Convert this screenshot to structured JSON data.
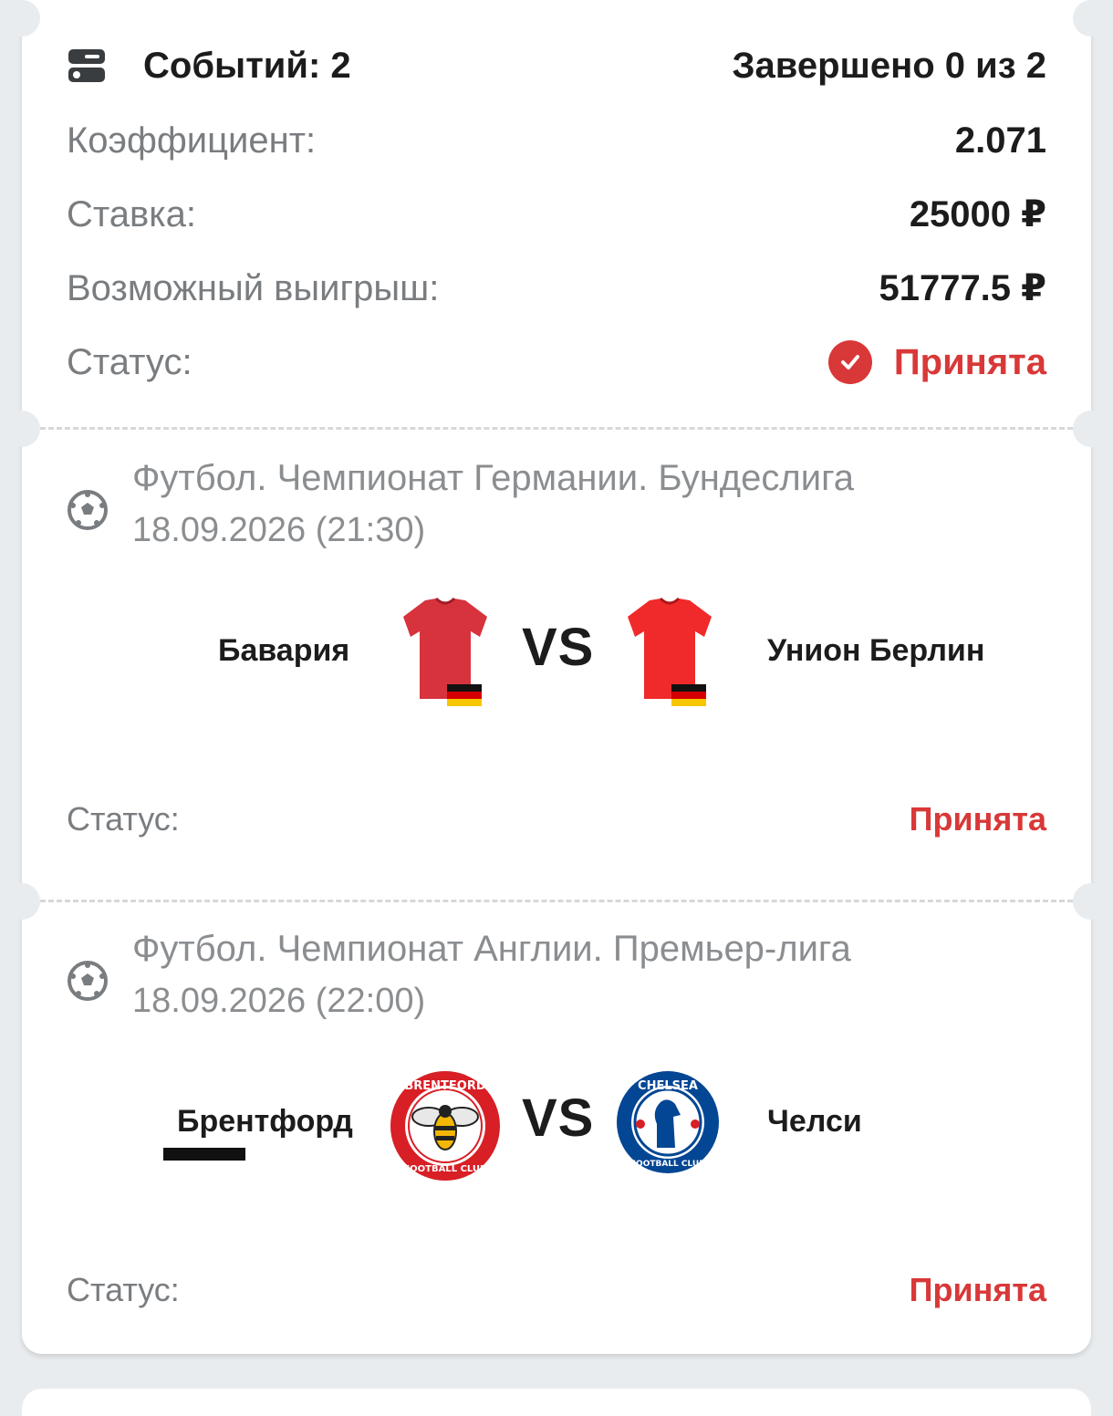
{
  "summary": {
    "events_label": "Событий: 2",
    "completed_label": "Завершено 0 из 2",
    "rows": [
      {
        "label": "Коэффициент:",
        "value": "2.071"
      },
      {
        "label": "Ставка:",
        "value": "25000 ₽"
      },
      {
        "label": "Возможный выигрыш:",
        "value": "51777.5 ₽"
      }
    ],
    "status_label": "Статус:",
    "status_value": "Принята"
  },
  "events": [
    {
      "league": "Футбол. Чемпионат Германии. Бундеслига",
      "datetime": "18.09.2026 (21:30)",
      "home": "Бавария",
      "away": "Унион Берлин",
      "vs": "VS",
      "status_label": "Статус:",
      "status_value": "Принята",
      "home_icon": "red-jersey-germany-flag",
      "away_icon": "red-jersey-germany-flag"
    },
    {
      "league": "Футбол. Чемпионат Англии. Премьер-лига",
      "datetime": "18.09.2026 (22:00)",
      "home": "Брентфорд",
      "away": "Челси",
      "vs": "VS",
      "status_label": "Статус:",
      "status_value": "Принята",
      "home_icon": "brentford-crest",
      "away_icon": "chelsea-crest",
      "home_crest_text": "BRENTFORD FOOTBALL CLUB",
      "away_crest_text": "CHELSEA FOOTBALL CLUB"
    }
  ],
  "colors": {
    "accent_red": "#d93838",
    "label_gray": "#7a7d80",
    "background": "#e9ecee"
  }
}
